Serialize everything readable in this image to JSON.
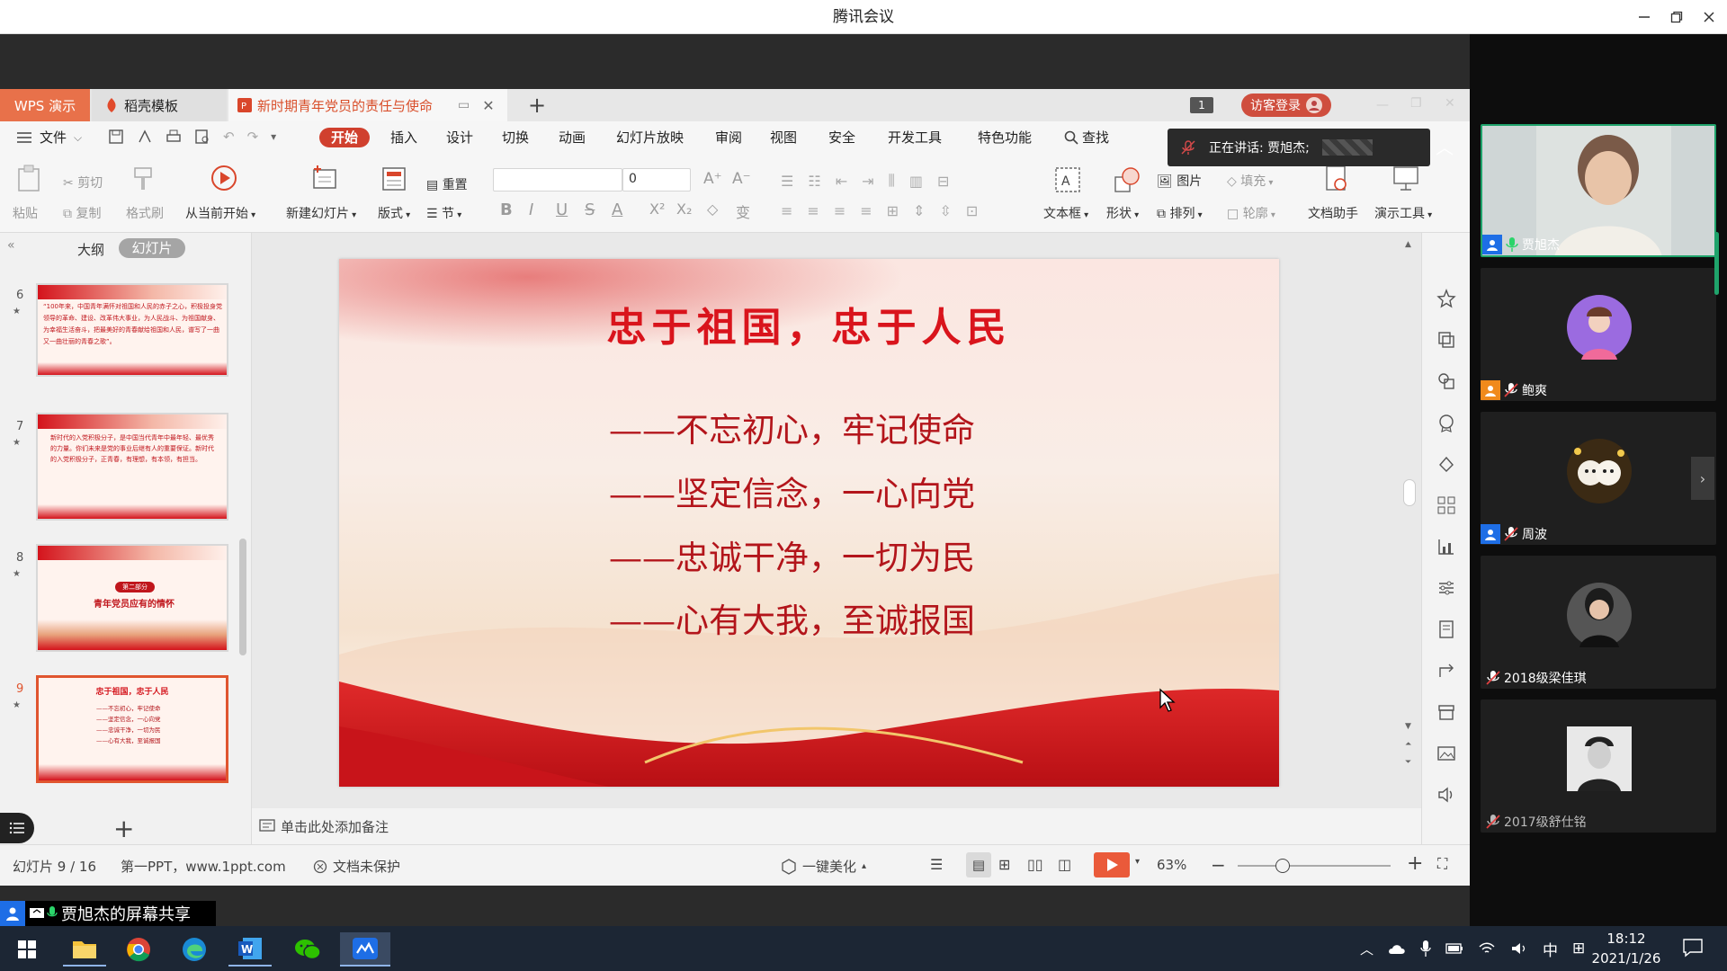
{
  "meeting": {
    "title": "腾讯会议",
    "speaking": "正在讲话: 贾旭杰;",
    "share_label": "贾旭杰的屏幕共享"
  },
  "wps": {
    "tabs": {
      "app": "WPS 演示",
      "template": "稻壳模板",
      "document": "新时期青年党员的责任与使命"
    },
    "visitor_login": "访客登录",
    "file_menu": "文件",
    "menu": [
      "开始",
      "插入",
      "设计",
      "切换",
      "动画",
      "幻灯片放映",
      "审阅",
      "视图",
      "安全",
      "开发工具",
      "特色功能"
    ],
    "search": "查找",
    "ribbon": {
      "paste": "粘贴",
      "cut": "剪切",
      "copy": "复制",
      "format_painter": "格式刷",
      "from_current": "从当前开始",
      "new_slide": "新建幻灯片",
      "layout": "版式",
      "reset": "重置",
      "section": "节",
      "font_size": "0",
      "picture": "图片",
      "fill": "填充",
      "arrange": "排列",
      "outline": "轮廓",
      "textbox": "文本框",
      "shape": "形状",
      "doc_helper": "文档助手",
      "present_tools": "演示工具"
    },
    "panel_tabs": {
      "outline": "大纲",
      "slides": "幻灯片"
    },
    "thumbnails": [
      {
        "num": "6",
        "text": "“100年来，中国青年满怀对祖国和人民的赤子之心，积极投身党领导的革命、建设、改革伟大事业，为人民战斗、为祖国献身、为幸福生活奋斗，把最美好的青春献给祖国和人民，谱写了一曲又一曲壮丽的青春之歌”。"
      },
      {
        "num": "7",
        "text": "新时代的入党积极分子，是中国当代青年中最年轻、最优秀的力量。你们未来是党的事业后继有人的重要保证。新时代的入党积极分子，正青春，有理想，有本领，有担当。"
      },
      {
        "num": "8",
        "badge": "第二部分",
        "text": "青年党员应有的情怀"
      },
      {
        "num": "9",
        "title": "忠于祖国，忠于人民",
        "lines": [
          "——不忘初心，牢记使命",
          "——坚定信念，一心向党",
          "——忠诚干净，一切为民",
          "——心有大我，至诚报国"
        ]
      }
    ],
    "slide": {
      "title": "忠于祖国，忠于人民",
      "lines": [
        "——不忘初心，牢记使命",
        "——坚定信念，一心向党",
        "——忠诚干净，一切为民",
        "——心有大我，至诚报国"
      ]
    },
    "notes_placeholder": "单击此处添加备注",
    "status": {
      "slide_count": "幻灯片 9 / 16",
      "template_name": "第一PPT，www.1ppt.com",
      "protection": "文档未保护",
      "beautify": "一键美化",
      "zoom": "63%"
    }
  },
  "participants": [
    {
      "name": "贾旭杰",
      "mic": "on",
      "host": true
    },
    {
      "name": "鲍爽",
      "mic": "muted",
      "host": true
    },
    {
      "name": "周波",
      "mic": "muted",
      "host": true
    },
    {
      "name": "2018级梁佳琪",
      "mic": "muted",
      "host": false
    },
    {
      "name": "2017级舒仕铭",
      "mic": "muted",
      "host": false
    }
  ],
  "taskbar": {
    "ime": "中",
    "time": "18:12",
    "date": "2021/1/26"
  },
  "colors": {
    "wps_accent": "#e8714a",
    "start_tab": "#d0402e",
    "slide_title": "#d9141c",
    "slide_text": "#b3151b"
  }
}
